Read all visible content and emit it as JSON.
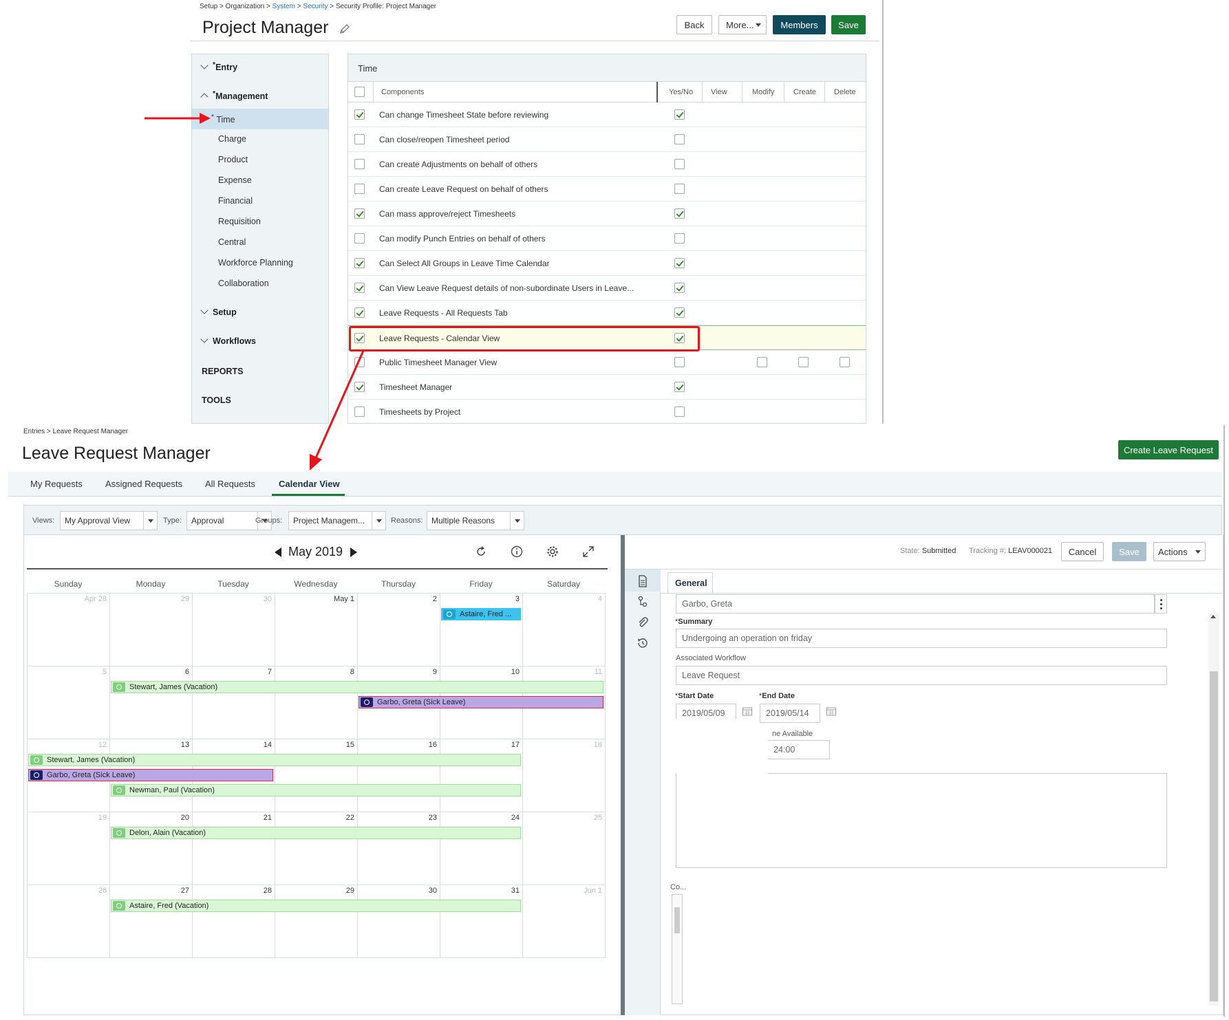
{
  "security": {
    "breadcrumb": {
      "setup": "Setup",
      "sep1": " > ",
      "org": "Organization",
      "sep2": " > ",
      "system": "System",
      "sep3": " > ",
      "security": "Security",
      "sep4": " > ",
      "profile": "Security Profile: Project Manager"
    },
    "title": "Project Manager",
    "buttons": {
      "back": "Back",
      "more": "More...",
      "members": "Members",
      "save": "Save"
    },
    "sidebar": {
      "entry": "Entry",
      "management": "Management",
      "items": [
        "Time",
        "Charge",
        "Product",
        "Expense",
        "Financial",
        "Requisition",
        "Central",
        "Workforce Planning",
        "Collaboration"
      ],
      "setup": "Setup",
      "workflows": "Workflows",
      "reports": "REPORTS",
      "tools": "TOOLS",
      "star": "*"
    },
    "panel_title": "Time",
    "columns": {
      "components": "Components",
      "yesno": "Yes/No",
      "view": "View",
      "modify": "Modify",
      "create": "Create",
      "delete": "Delete"
    },
    "rows": [
      {
        "label": "Can change Timesheet State before reviewing",
        "checked": true
      },
      {
        "label": "Can close/reopen Timesheet period",
        "checked": false
      },
      {
        "label": "Can create Adjustments on behalf of others",
        "checked": false
      },
      {
        "label": "Can create Leave Request on behalf of others",
        "checked": false
      },
      {
        "label": "Can mass approve/reject Timesheets",
        "checked": true
      },
      {
        "label": "Can modify Punch Entries on behalf of others",
        "checked": false
      },
      {
        "label": "Can Select All Groups in Leave Time Calendar",
        "checked": true
      },
      {
        "label": "Can View Leave Request details of non-subordinate Users in Leave...",
        "checked": true
      },
      {
        "label": "Leave Requests - All Requests Tab",
        "checked": true
      },
      {
        "label": "Leave Requests - Calendar View",
        "checked": true
      },
      {
        "label": "Public Timesheet Manager View",
        "checked": false
      },
      {
        "label": "Timesheet Manager",
        "checked": true
      },
      {
        "label": "Timesheets by Project",
        "checked": false
      }
    ]
  },
  "leave": {
    "breadcrumb": "Entries > Leave Request Manager",
    "title": "Leave Request Manager",
    "create_button": "Create Leave Request",
    "tabs": [
      "My Requests",
      "Assigned Requests",
      "All Requests",
      "Calendar View"
    ],
    "filters": {
      "views_label": "Views:",
      "views_value": "My Approval View",
      "type_label": "Type:",
      "type_value": "Approval",
      "groups_label": "Groups:",
      "groups_value": "Project Managem...",
      "reasons_label": "Reasons:",
      "reasons_value": "Multiple Reasons"
    },
    "calendar": {
      "month": "May 2019",
      "weekdays": [
        "Sunday",
        "Monday",
        "Tuesday",
        "Wednesday",
        "Thursday",
        "Friday",
        "Saturday"
      ],
      "weeks": [
        [
          "Apr 28",
          "29",
          "30",
          "May 1",
          "2",
          "3",
          "4"
        ],
        [
          "5",
          "6",
          "7",
          "8",
          "9",
          "10",
          "11"
        ],
        [
          "12",
          "13",
          "14",
          "15",
          "16",
          "17",
          "18"
        ],
        [
          "19",
          "20",
          "21",
          "22",
          "23",
          "24",
          "25"
        ],
        [
          "26",
          "27",
          "28",
          "29",
          "30",
          "31",
          "Jun 1"
        ]
      ],
      "events": {
        "astaire_short": "Astaire, Fred ...",
        "stewart1": "Stewart, James (Vacation)",
        "garbo1": "Garbo, Greta (Sick Leave)",
        "stewart2": "Stewart, James (Vacation)",
        "garbo2": "Garbo, Greta (Sick Leave)",
        "newman": "Newman, Paul (Vacation)",
        "delon": "Delon, Alain (Vacation)",
        "astaire": "Astaire, Fred (Vacation)"
      }
    },
    "detail": {
      "state_label": "State:",
      "state_value": "Submitted",
      "tracking_label": "Tracking #:",
      "tracking_value": "LEAV000021",
      "cancel": "Cancel",
      "save": "Save",
      "actions": "Actions",
      "tab_general": "General",
      "user": "Garbo, Greta",
      "summary_label": "Summary",
      "summary_value": "Undergoing an operation on friday",
      "workflow_label": "Associated Workflow",
      "workflow_value": "Leave Request",
      "start_label": "Start Date",
      "start_value": "2019/05/09",
      "end_label": "End Date",
      "end_value": "2019/05/14",
      "avail_label": "ne Available",
      "avail_value": "24:00",
      "comments_label": "Co...",
      "star": "*"
    }
  },
  "colors": {
    "accent_dark": "#0e4a5c",
    "save_green": "#1d7a36",
    "highlight_red": "#e8141c",
    "event_green": "#d9f6d5",
    "event_purple": "#b8a9e6",
    "event_blue": "#3ec3ef"
  }
}
